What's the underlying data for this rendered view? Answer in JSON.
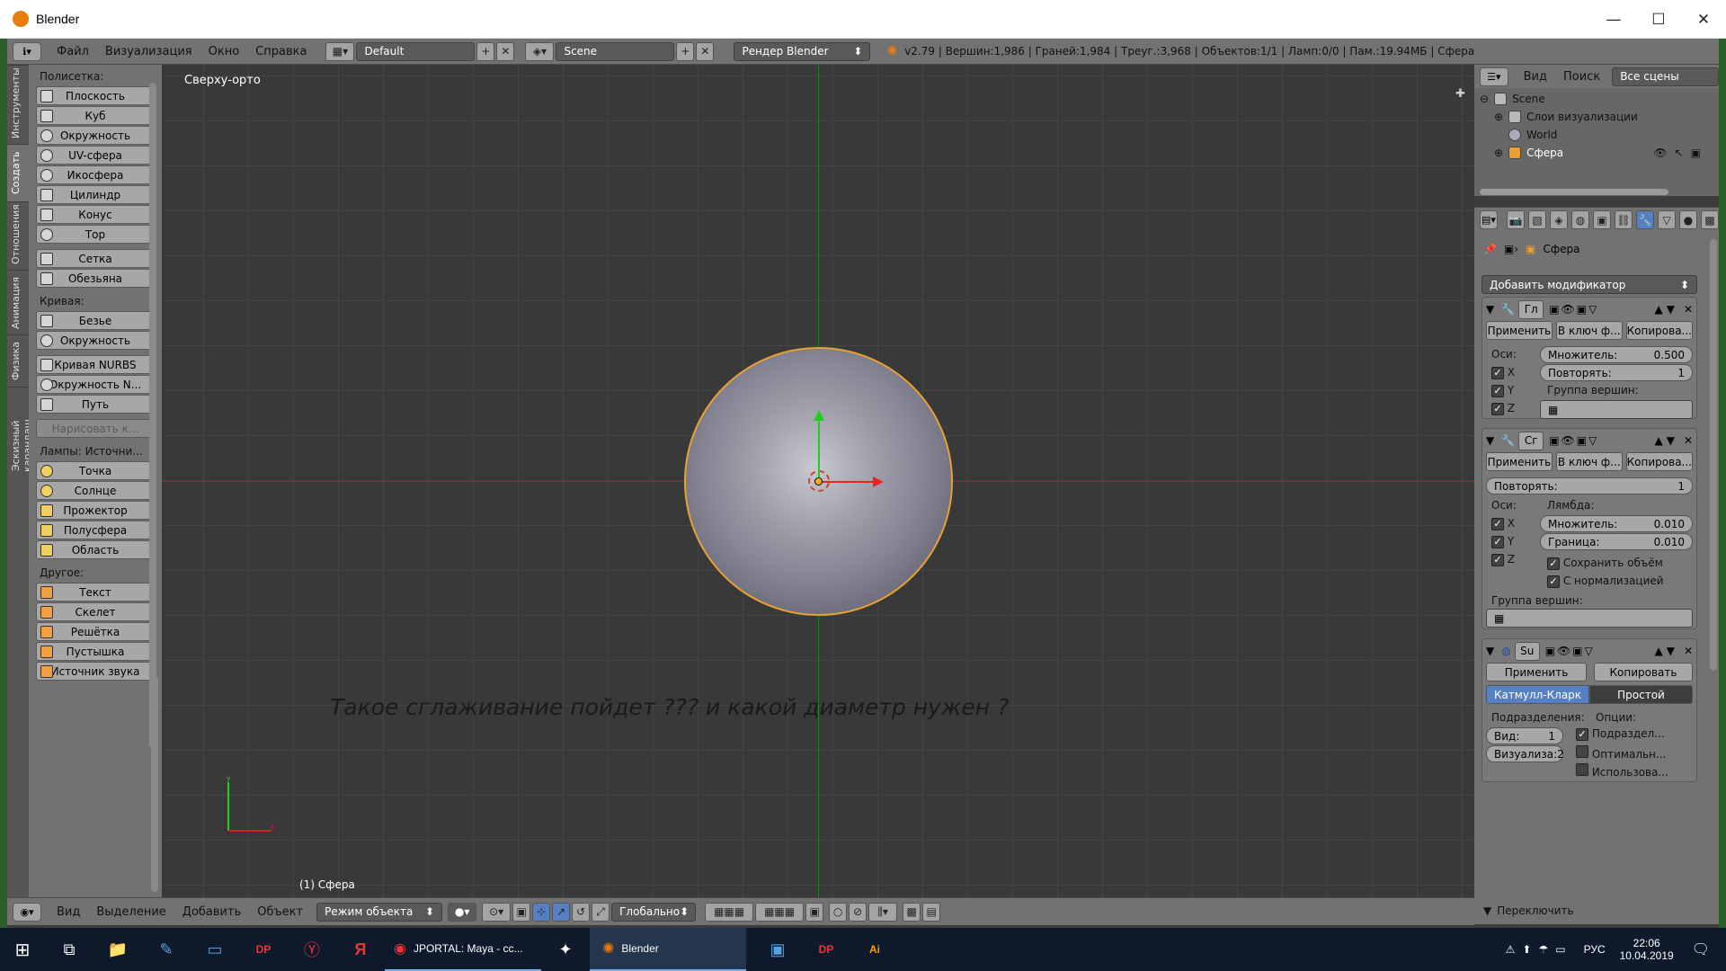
{
  "window": {
    "title": "Blender",
    "minimize": "—",
    "maximize": "☐",
    "close": "✕"
  },
  "topbar": {
    "menus": [
      "Файл",
      "Визуализация",
      "Окно",
      "Справка"
    ],
    "layout": "Default",
    "scene": "Scene",
    "engine": "Рендер Blender",
    "stats": "v2.79 | Вершин:1,986 | Граней:1,984 | Треуг.:3,968 | Объектов:1/1 | Ламп:0/0 | Пам.:19.94МБ | Сфера"
  },
  "left_tabs": [
    "Инструменты",
    "Создать",
    "Отношения",
    "Анимация",
    "Физика",
    "Эскизный карандаш"
  ],
  "toolshelf": {
    "mesh_header": "Полисетка:",
    "mesh": [
      "Плоскость",
      "Куб",
      "Окружность",
      "UV-сфера",
      "Икосфера",
      "Цилиндр",
      "Конус",
      "Тор"
    ],
    "mesh2": [
      "Сетка",
      "Обезьяна"
    ],
    "curve_header": "Кривая:",
    "curve": [
      "Безье",
      "Окружность"
    ],
    "curve2": [
      "Кривая NURBS",
      "Окружность N...",
      "Путь"
    ],
    "draw_curve": "Нарисовать к...",
    "lamp_header": "Лампы: Источни...",
    "lamp": [
      "Точка",
      "Солнце",
      "Прожектор",
      "Полусфера",
      "Область"
    ],
    "other_header": "Другое:",
    "other": [
      "Текст",
      "Скелет",
      "Решётка",
      "Пустышка",
      "Источник звука"
    ]
  },
  "viewport": {
    "view_name": "Сверху-орто",
    "annotation": "Такое сглаживание пойдет ??? и какой диаметр нужен ?",
    "object_label": "(1) Сфера",
    "axis_x": "x",
    "axis_y": "y"
  },
  "bottombar": {
    "menus": [
      "Вид",
      "Выделение",
      "Добавить",
      "Объект"
    ],
    "mode": "Режим объекта",
    "orientation": "Глобально"
  },
  "outliner": {
    "menus": [
      "Вид",
      "Поиск"
    ],
    "filter": "Все сцены",
    "tree": [
      "Scene",
      "Слои визуализации",
      "World",
      "Сфера"
    ]
  },
  "properties": {
    "object_name": "Сфера",
    "add_modifier": "Добавить модификатор",
    "apply": "Применить",
    "to_shape": "В ключ ф...",
    "copy": "Копирова...",
    "mod1": {
      "name": "Гл",
      "axes": "Оси:",
      "factor": "Множитель:",
      "factor_val": "0.500",
      "repeat": "Повторять:",
      "repeat_val": "1",
      "vgroup": "Группа вершин:",
      "x": "X",
      "y": "Y",
      "z": "Z"
    },
    "mod2": {
      "name": "Сг",
      "repeat": "Повторять:",
      "repeat_val": "1",
      "axes": "Оси:",
      "lambda": "Лямбда:",
      "factor": "Множитель:",
      "factor_val": "0.010",
      "border": "Граница:",
      "border_val": "0.010",
      "preserve": "Сохранить объём",
      "normalized": "С нормализацией",
      "vgroup": "Группа вершин:",
      "x": "X",
      "y": "Y",
      "z": "Z"
    },
    "mod3": {
      "name": "Su",
      "apply": "Применить",
      "copy": "Копировать",
      "tab_cc": "Катмулл-Кларк",
      "tab_simple": "Простой",
      "subdiv": "Подразделения:",
      "options": "Опции:",
      "view": "Вид:",
      "view_val": "1",
      "render": "Визуализа:2",
      "opt1": "Подраздел...",
      "opt2": "Оптимальн...",
      "opt3": "Использова..."
    },
    "toggle": "Переключить"
  },
  "taskbar": {
    "items": [
      "JPORTAL: Maya - сс...",
      "Blender"
    ],
    "lang": "РУС",
    "time": "22:06",
    "date": "10.04.2019"
  }
}
